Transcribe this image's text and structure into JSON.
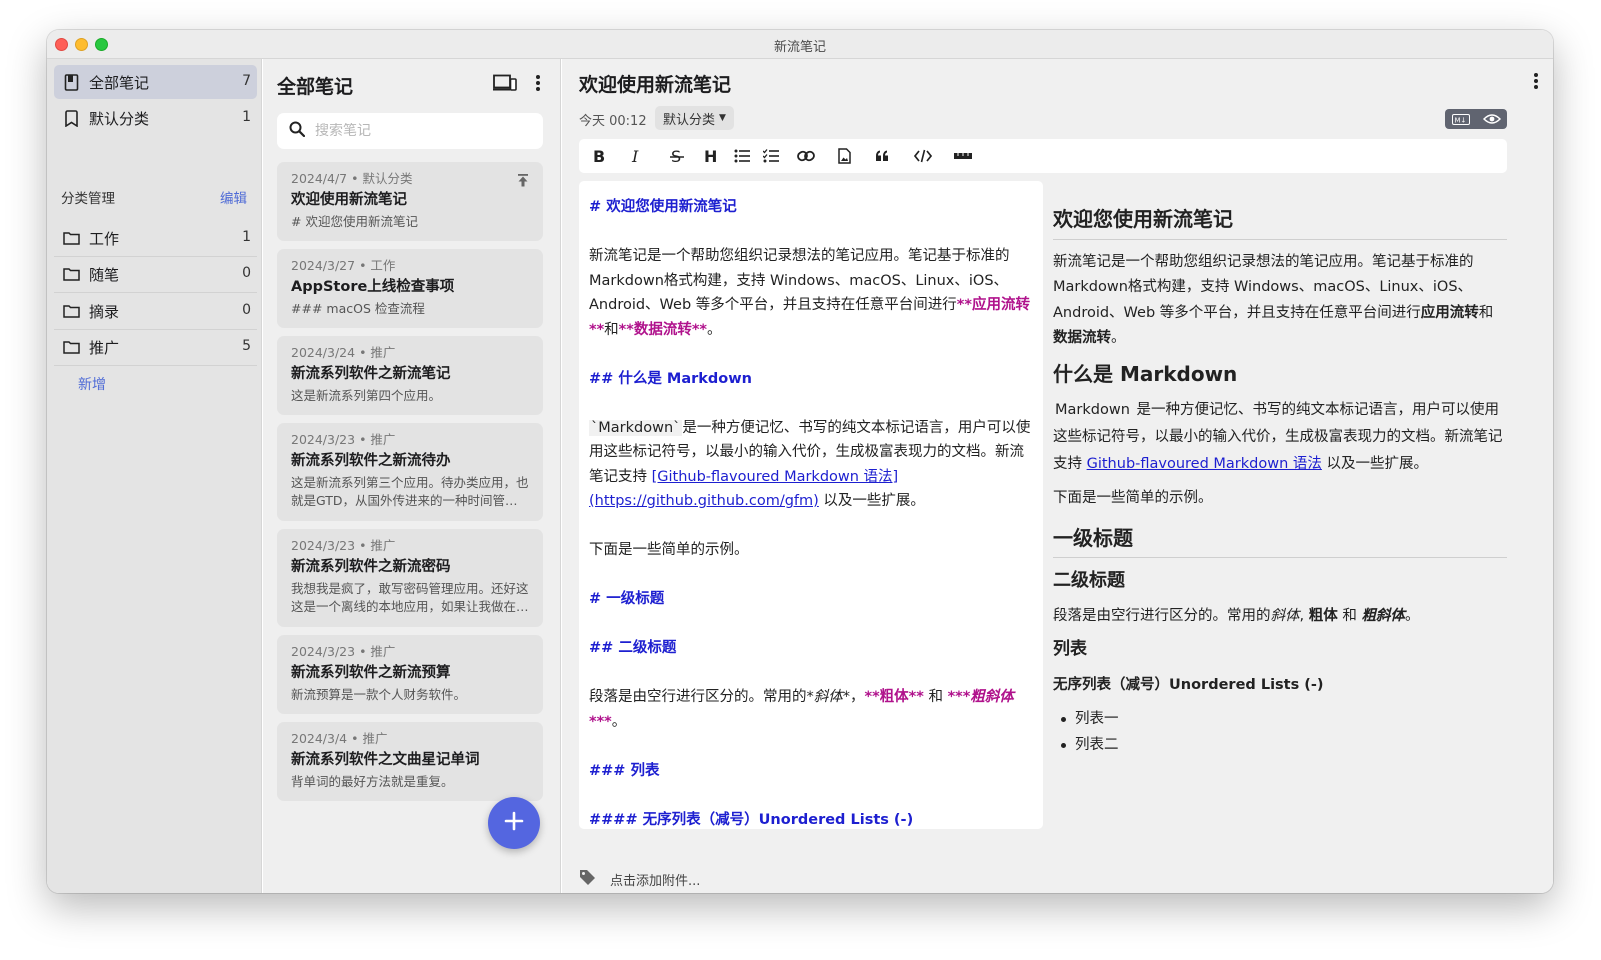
{
  "window": {
    "title": "新流笔记"
  },
  "sidebar": {
    "items": [
      {
        "label": "全部笔记",
        "count": "7",
        "icon": "notebook-icon"
      },
      {
        "label": "默认分类",
        "count": "1",
        "icon": "bookmark-icon"
      }
    ],
    "section_title": "分类管理",
    "edit_label": "编辑",
    "folders": [
      {
        "label": "工作",
        "count": "1"
      },
      {
        "label": "随笔",
        "count": "0"
      },
      {
        "label": "摘录",
        "count": "0"
      },
      {
        "label": "推广",
        "count": "5"
      }
    ],
    "add_label": "新增"
  },
  "notelist": {
    "title": "全部笔记",
    "search_placeholder": "搜索笔记",
    "notes": [
      {
        "meta": "2024/4/7 • 默认分类",
        "title": "欢迎使用新流笔记",
        "preview": "# 欢迎您使用新流笔记"
      },
      {
        "meta": "2024/3/27 • 工作",
        "title": "AppStore上线检查事项",
        "preview": "### macOS 检查流程"
      },
      {
        "meta": "2024/3/24 • 推广",
        "title": "新流系列软件之新流笔记",
        "preview": "这是新流系列第四个应用。"
      },
      {
        "meta": "2024/3/23 • 推广",
        "title": "新流系列软件之新流待办",
        "preview": "这是新流系列第三个应用。待办类应用，也就是GTD，从国外传进来的一种时间管理方法"
      },
      {
        "meta": "2024/3/23 • 推广",
        "title": "新流系列软件之新流密码",
        "preview": "我想我是疯了，敢写密码管理应用。还好这这是一个离线的本地应用，如果让我做在线的"
      },
      {
        "meta": "2024/3/23 • 推广",
        "title": "新流系列软件之新流预算",
        "preview": "新流预算是一款个人财务软件。"
      },
      {
        "meta": "2024/3/4 • 推广",
        "title": "新流系列软件之文曲星记单词",
        "preview": "背单词的最好方法就是重复。"
      }
    ]
  },
  "editor": {
    "title": "欢迎使用新流笔记",
    "date": "今天 00:12",
    "category": "默认分类",
    "mode_md": "M↓",
    "attach_label": "点击添加附件...",
    "toolbar": [
      "bold-icon",
      "italic-icon",
      "strikethrough-icon",
      "heading-icon",
      "bullet-list-icon",
      "task-list-icon",
      "link-icon",
      "image-icon",
      "quote-icon",
      "code-icon",
      "hr-icon"
    ],
    "source": {
      "h1": "# 欢迎您使用新流笔记",
      "p1a": "新流笔记是一个帮助您组织记录想法的笔记应用。笔记基于标准的Markdown格式构建，支持 Windows、macOS、Linux、iOS、Android、Web 等多个平台，并且支持在任意平台间进行",
      "p1b": "**应用流转**",
      "p1c": "和",
      "p1d": "**数据流转**",
      "p1e": "。",
      "h2": "## 什么是 Markdown",
      "p2a": "`Markdown`",
      "p2b": "是一种方便记忆、书写的纯文本标记语言，用户可以使用这些标记符号，以最小的输入代价，生成极富表现力的文档。新流笔记支持 ",
      "p2c": "[Github-flavoured Markdown 语法](https://github.github.com/gfm)",
      "p2d": " 以及一些扩展。",
      "p3": "下面是一些简单的示例。",
      "h1b": "# 一级标题",
      "h2b": "## 二级标题",
      "p4a": "段落是由空行进行区分的。常用的",
      "p4b": "*斜体*",
      "p4c": "，",
      "p4d": "**粗体**",
      "p4e": " 和 ",
      "p4f": "***粗斜体***",
      "p4g": "。",
      "h3": "### 列表",
      "h4": "#### 无序列表（减号）Unordered Lists (-)"
    },
    "preview": {
      "h1": "欢迎您使用新流笔记",
      "p1a": "新流笔记是一个帮助您组织记录想法的笔记应用。笔记基于标准的Markdown格式构建，支持 Windows、macOS、Linux、iOS、Android、Web 等多个平台，并且支持在任意平台间进行",
      "p1b": "应用流转",
      "p1c": "和",
      "p1d": "数据流转",
      "p1e": "。",
      "h2": "什么是 Markdown",
      "p2a": "Markdown",
      "p2b": " 是一种方便记忆、书写的纯文本标记语言，用户可以使用这些标记符号，以最小的输入代价，生成极富表现力的文档。新流笔记支持 ",
      "p2c": "Github-flavoured Markdown 语法",
      "p2d": " 以及一些扩展。",
      "p3": "下面是一些简单的示例。",
      "h1b": "一级标题",
      "h2b": "二级标题",
      "p4a": "段落是由空行进行区分的。常用的",
      "p4b": "斜体",
      "p4c": ", ",
      "p4d": "粗体",
      "p4e": " 和 ",
      "p4f": "粗斜体",
      "p4g": "。",
      "h3": "列表",
      "h4": "无序列表（减号）Unordered Lists (-)",
      "list": [
        "列表一",
        "列表二"
      ]
    }
  },
  "colors": {
    "accent": "#4f6bd6",
    "fab": "#5466e0",
    "md_heading": "#1d1fd0",
    "md_bold": "#b0128c"
  }
}
